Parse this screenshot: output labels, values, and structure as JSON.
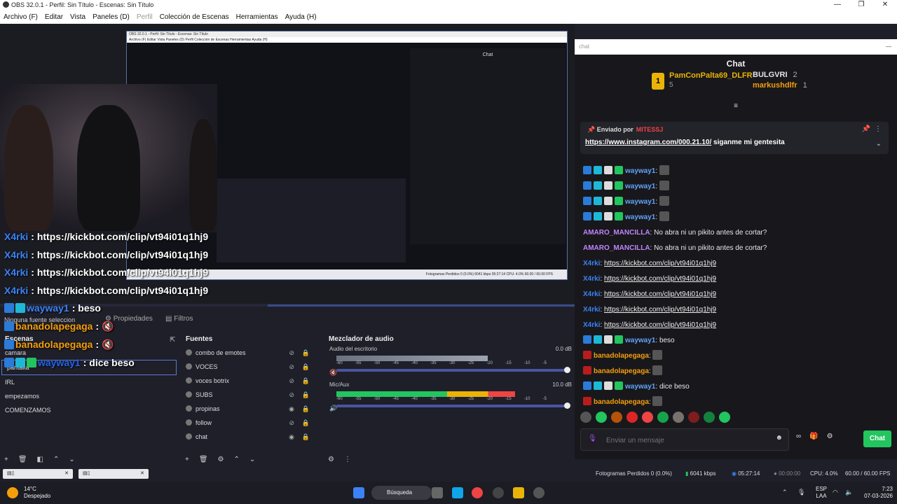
{
  "window": {
    "title": "OBS 32.0.1 - Perfil: Sin Título - Escenas: Sin Título",
    "controls": [
      "—",
      "❐",
      "✕"
    ]
  },
  "menu": [
    {
      "label": "Archivo (F)",
      "enabled": true
    },
    {
      "label": "Editar",
      "enabled": true
    },
    {
      "label": "Vista",
      "enabled": true
    },
    {
      "label": "Paneles (D)",
      "enabled": true
    },
    {
      "label": "Perfil",
      "enabled": false
    },
    {
      "label": "Colección de Escenas",
      "enabled": true
    },
    {
      "label": "Herramientas",
      "enabled": true
    },
    {
      "label": "Ayuda (H)",
      "enabled": true
    }
  ],
  "preview": {
    "nested_title": "OBS 32.0.1 - Perfil: Sin Título - Escenas: Sin Título",
    "nested_menu": "Archivo (F)   Editar   Vista   Paneles (D)   Perfil   Colección de Escenas   Herramientas   Ayuda (H)",
    "nested_chat_title": "Chat",
    "nested_status": "Fotogramas Perdidos 0 (0.0%)   6041 kbps   05:27:14   CPU: 4.0%   60.00 / 60.00 FPS",
    "overlay_lines": [
      {
        "user": "X4rki",
        "sep": ":",
        "text": "https://kickbot.com/clip/vt94i01q1hj9"
      },
      {
        "user": "X4rki",
        "sep": ":",
        "text": "https://kickbot.com/clip/vt94i01q1hj9"
      },
      {
        "user": "X4rki",
        "sep": ":",
        "text": "https://kickbot.com/clip/vt94i01q1hj9"
      },
      {
        "user": "X4rki",
        "sep": ":",
        "text": "https://kickbot.com/clip/vt94i01q1hj9"
      },
      {
        "user": "wayway1",
        "sep": ":",
        "text": "beso"
      },
      {
        "user": "banadolapegaga",
        "sep": ":",
        "text": ""
      },
      {
        "user": "banadolapegaga",
        "sep": ":",
        "text": ""
      },
      {
        "user": "wayway1",
        "sep": ":",
        "text": "dice beso"
      }
    ]
  },
  "source_toolbar": {
    "no_source": "Ninguna fuente seleccion",
    "properties": "Propiedades",
    "filters": "Filtros"
  },
  "scenes": {
    "title": "Escenas",
    "items": [
      "camara",
      "pantalla",
      "IRL",
      "empezamos",
      "COMENZAMOS"
    ],
    "selected": "pantalla"
  },
  "sources": {
    "title": "Fuentes",
    "items": [
      {
        "label": "combo de emotes",
        "visible": false
      },
      {
        "label": "VOCES",
        "visible": false
      },
      {
        "label": "voces botrix",
        "visible": false
      },
      {
        "label": "SUBS",
        "visible": false
      },
      {
        "label": "propinas",
        "visible": true
      },
      {
        "label": "follow",
        "visible": false
      },
      {
        "label": "chat",
        "visible": true
      }
    ]
  },
  "mixer": {
    "title": "Mezclador de audio",
    "channels": [
      {
        "name": "Audio del escritorio",
        "db": "0.0 dB",
        "level": 0.72,
        "muted": true
      },
      {
        "name": "Mic/Aux",
        "db": "10.0 dB",
        "level": 0.85,
        "muted": false
      }
    ],
    "ticks": [
      "-60",
      "-55",
      "-50",
      "-45",
      "-40",
      "-35",
      "-30",
      "-25",
      "-20",
      "-15",
      "-10",
      "-5"
    ]
  },
  "chat": {
    "window_label": "chat",
    "title": "Chat",
    "top_gifters": [
      {
        "rank": "1",
        "name": "PamConPalta69_DLFR",
        "count": "5"
      },
      {
        "name": "BULGVRI",
        "count": "2"
      },
      {
        "name": "markushdlfr",
        "count": "1"
      }
    ],
    "pinned": {
      "by_label": "Enviado por",
      "user": "MITESSJ",
      "text": "https://www.instagram.com/000.21.10/",
      "suffix": " siganme mi gentesita"
    },
    "messages": [
      {
        "user": "wayway1",
        "kind": "w",
        "text": "",
        "badges": true
      },
      {
        "user": "wayway1",
        "kind": "w",
        "text": "",
        "badges": true
      },
      {
        "user": "wayway1",
        "kind": "w",
        "text": "",
        "badges": true
      },
      {
        "user": "wayway1",
        "kind": "w",
        "text": "",
        "badges": true
      },
      {
        "user": "AMARO_MANCILLA",
        "kind": "p",
        "text": "No abra ni un pikito antes de cortar?",
        "badges": false
      },
      {
        "user": "AMARO_MANCILLA",
        "kind": "p",
        "text": "No abra ni un pikito antes de cortar?",
        "badges": false
      },
      {
        "user": "X4rki",
        "kind": "b",
        "link": "https://kickbot.com/clip/vt94i01q1hj9",
        "badges": false
      },
      {
        "user": "X4rki",
        "kind": "b",
        "link": "https://kickbot.com/clip/vt94i01q1hj9",
        "badges": false
      },
      {
        "user": "X4rki",
        "kind": "b",
        "link": "https://kickbot.com/clip/vt94i01q1hj9",
        "badges": false
      },
      {
        "user": "X4rki",
        "kind": "b",
        "link": "https://kickbot.com/clip/vt94i01q1hj9",
        "badges": false
      },
      {
        "user": "X4rki",
        "kind": "b",
        "link": "https://kickbot.com/clip/vt94i01q1hj9",
        "badges": false
      },
      {
        "user": "wayway1",
        "kind": "w",
        "text": "beso",
        "badges": true
      },
      {
        "user": "banadolapegaga",
        "kind": "o",
        "text": "",
        "badges": false
      },
      {
        "user": "banadolapegaga",
        "kind": "o",
        "text": "",
        "badges": false
      },
      {
        "user": "wayway1",
        "kind": "w",
        "text": "dice beso",
        "badges": true
      },
      {
        "user": "banadolapegaga",
        "kind": "o",
        "text": "",
        "badges": false
      }
    ],
    "input_placeholder": "Enviar un mensaje",
    "send_label": "Chat",
    "accent": "#22c55e"
  },
  "status": {
    "dropped": "Fotogramas Perdidos 0 (0.0%)",
    "kbps": "6041 kbps",
    "live": "05:27:14",
    "rec": "00:00:00",
    "cpu": "CPU: 4.0%",
    "fps": "60.00 / 60.00 FPS"
  },
  "taskbar": {
    "temp": "14°C",
    "weather": "Despejado",
    "search": "Búsqueda",
    "lang1": "ESP",
    "lang2": "LAA",
    "time": "7:23",
    "date": "07-03-2026"
  }
}
